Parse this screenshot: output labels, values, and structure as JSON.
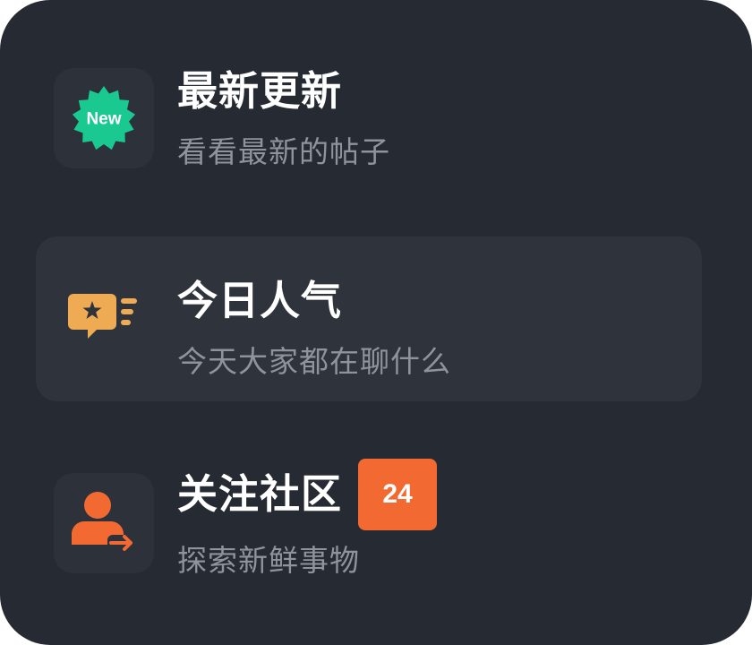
{
  "menu": {
    "items": [
      {
        "title": "最新更新",
        "subtitle": "看看最新的帖子",
        "icon": "new-badge-icon",
        "icon_text": "New",
        "icon_color": "#19c98f",
        "active": false
      },
      {
        "title": "今日人气",
        "subtitle": "今天大家都在聊什么",
        "icon": "star-chat-icon",
        "icon_color": "#efab54",
        "active": true
      },
      {
        "title": "关注社区",
        "subtitle": "探索新鲜事物",
        "icon": "user-follow-icon",
        "icon_color": "#f26a32",
        "badge": "24",
        "active": false
      }
    ]
  },
  "colors": {
    "panel_background": "#252a33",
    "active_item_background": "#2e333c",
    "icon_box_background": "#2c313a",
    "title_text": "#ffffff",
    "subtitle_text": "#8f949b",
    "badge_background": "#f26a32"
  }
}
